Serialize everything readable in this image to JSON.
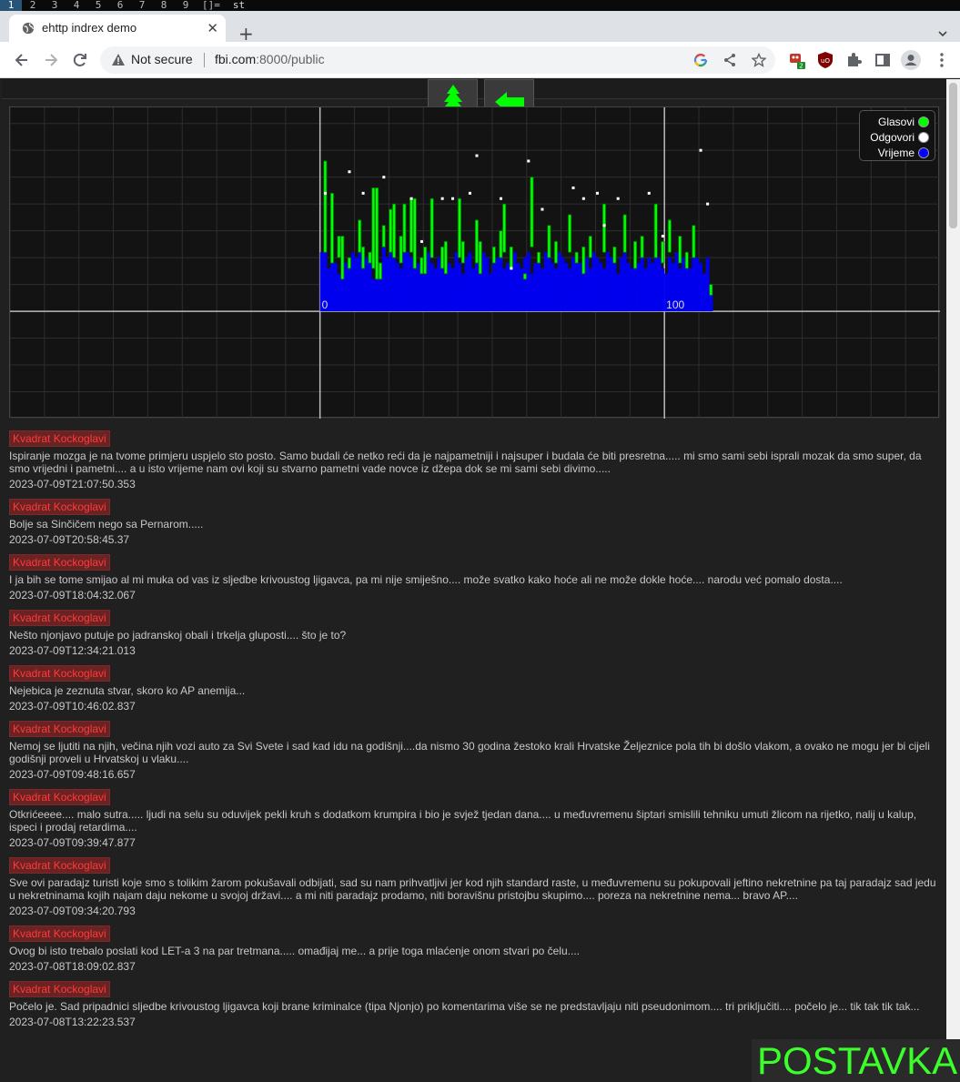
{
  "wm": {
    "workspaces": [
      "1",
      "2",
      "3",
      "4",
      "5",
      "6",
      "7",
      "8",
      "9"
    ],
    "active_workspace": "1",
    "layout": "[]=",
    "title": "st"
  },
  "browser": {
    "tab_title": "ehttp indrex demo",
    "security_label": "Not secure",
    "url_host": "fbi.com",
    "url_rest": ":8000/public",
    "extension_badge": "2"
  },
  "nav": {
    "tree_icon": "tree-icon",
    "back_icon": "arrow-left-icon",
    "accent": "#00ff00"
  },
  "chart_data": {
    "type": "bar",
    "xlim": [
      -90,
      180
    ],
    "ylim": [
      -20,
      38
    ],
    "x_tick_labels": [
      "0",
      "100"
    ],
    "legend": {
      "placement": "top-right",
      "entries": [
        {
          "name": "Glasovi",
          "color": "#00ff00"
        },
        {
          "name": "Odgovori",
          "color": "#ffffff"
        },
        {
          "name": "Vrijeme",
          "color": "#0000ff"
        }
      ]
    },
    "series": [
      {
        "name": "Vrijeme",
        "color": "#0000ee",
        "values": [
          11,
          11,
          8,
          10,
          9,
          7,
          11,
          9,
          8,
          11,
          10,
          11,
          10,
          10,
          9,
          6,
          11,
          8,
          12,
          10,
          11,
          10,
          9,
          8,
          12,
          11,
          10,
          8,
          9,
          10,
          7,
          11,
          9,
          8,
          10,
          11,
          10,
          9,
          8,
          11,
          9,
          7,
          10,
          11,
          8,
          10,
          9,
          11,
          10,
          7,
          9,
          10,
          11,
          8,
          9,
          10,
          11,
          9,
          8,
          10,
          11,
          7,
          9,
          10,
          8,
          11,
          10,
          9,
          8,
          11,
          10,
          9,
          8,
          10,
          11,
          9,
          7,
          10,
          8,
          11,
          10,
          9,
          8,
          11,
          10,
          9,
          7,
          10,
          11,
          9,
          8,
          10,
          9,
          11,
          8,
          10,
          9,
          11,
          10,
          8,
          7,
          10,
          9,
          11,
          8,
          10,
          9,
          8,
          11,
          10,
          9,
          7,
          10,
          5
        ]
      },
      {
        "name": "Glasovi",
        "color": "#00ff00",
        "segments": [
          [
            1,
            11,
            17
          ],
          [
            3,
            9,
            13
          ],
          [
            5,
            10,
            4
          ],
          [
            6,
            6,
            8
          ],
          [
            8,
            8,
            2
          ],
          [
            11,
            11,
            6
          ],
          [
            12,
            8,
            4
          ],
          [
            14,
            9,
            2
          ],
          [
            15,
            8,
            15
          ],
          [
            16,
            6,
            17
          ],
          [
            17,
            9,
            -3
          ],
          [
            18,
            12,
            4
          ],
          [
            20,
            11,
            8
          ],
          [
            21,
            10,
            10
          ],
          [
            23,
            9,
            5
          ],
          [
            24,
            11,
            9
          ],
          [
            26,
            11,
            10
          ],
          [
            27,
            8,
            13
          ],
          [
            29,
            7,
            3
          ],
          [
            30,
            7,
            5
          ],
          [
            32,
            10,
            11
          ],
          [
            35,
            8,
            4
          ],
          [
            36,
            7,
            6
          ],
          [
            40,
            10,
            11
          ],
          [
            41,
            9,
            4
          ],
          [
            45,
            9,
            8
          ],
          [
            46,
            7,
            6
          ],
          [
            50,
            9,
            3
          ],
          [
            52,
            10,
            5
          ],
          [
            53,
            11,
            9
          ],
          [
            55,
            8,
            4
          ],
          [
            59,
            7,
            -1
          ],
          [
            61,
            12,
            13
          ],
          [
            63,
            9,
            2
          ],
          [
            66,
            10,
            6
          ],
          [
            68,
            9,
            4
          ],
          [
            72,
            11,
            7
          ],
          [
            74,
            9,
            2
          ],
          [
            76,
            7,
            5
          ],
          [
            78,
            10,
            4
          ],
          [
            82,
            11,
            9
          ],
          [
            85,
            9,
            3
          ],
          [
            88,
            11,
            7
          ],
          [
            91,
            8,
            5
          ],
          [
            93,
            10,
            4
          ],
          [
            97,
            10,
            10
          ],
          [
            99,
            9,
            4
          ],
          [
            101,
            11,
            6
          ],
          [
            104,
            9,
            5
          ],
          [
            106,
            8,
            3
          ],
          [
            108,
            10,
            6
          ],
          [
            113,
            5,
            -2
          ]
        ]
      },
      {
        "name": "Odgovori",
        "color": "#ffffff",
        "markers": [
          [
            1,
            22
          ],
          [
            8,
            26
          ],
          [
            12,
            22
          ],
          [
            18,
            25
          ],
          [
            26,
            21
          ],
          [
            29,
            13
          ],
          [
            35,
            21
          ],
          [
            38,
            21
          ],
          [
            43,
            22
          ],
          [
            45,
            29
          ],
          [
            52,
            21
          ],
          [
            55,
            8
          ],
          [
            60,
            28
          ],
          [
            64,
            19
          ],
          [
            73,
            23
          ],
          [
            76,
            21
          ],
          [
            80,
            22
          ],
          [
            82,
            16
          ],
          [
            86,
            21
          ],
          [
            95,
            22
          ],
          [
            99,
            14
          ],
          [
            110,
            30
          ],
          [
            112,
            20
          ]
        ]
      }
    ]
  },
  "comments": [
    {
      "author": "Kvadrat Kockoglavi",
      "text": "Ispiranje mozga je na tvome primjeru uspjelo sto posto. Samo budali će netko reći da je najpametniji i najsuper i budala će biti presretna..... mi smo sami sebi isprali mozak da smo super, da smo vrijedni i pametni.... a u isto vrijeme nam ovi koji su stvarno pametni vade novce iz džepa dok se mi sami sebi divimo.....",
      "date": "2023-07-09T21:07:50.353"
    },
    {
      "author": "Kvadrat Kockoglavi",
      "text": "Bolje sa Sinčičem nego sa Pernarom.....",
      "date": "2023-07-09T20:58:45.37"
    },
    {
      "author": "Kvadrat Kockoglavi",
      "text": "I ja bih se tome smijao al mi muka od vas iz sljedbe krivoustog ljigavca, pa mi nije smiješno.... može svatko kako hoće ali ne može dokle hoće.... narodu već pomalo dosta....",
      "date": "2023-07-09T18:04:32.067"
    },
    {
      "author": "Kvadrat Kockoglavi",
      "text": "Nešto njonjavo putuje po jadranskoj obali i trkelja gluposti.... što je to?",
      "date": "2023-07-09T12:34:21.013"
    },
    {
      "author": "Kvadrat Kockoglavi",
      "text": "Nejebica je zeznuta stvar, skoro ko AP anemija...",
      "date": "2023-07-09T10:46:02.837"
    },
    {
      "author": "Kvadrat Kockoglavi",
      "text": "Nemoj se ljutiti na njih, večina njih vozi auto za Svi Svete i sad kad idu na godišnji....da nismo 30 godina žestoko krali Hrvatske Željeznice pola tih bi došlo vlakom, a ovako ne mogu jer bi cijeli godišnji proveli u Hrvatskoj u vlaku....",
      "date": "2023-07-09T09:48:16.657"
    },
    {
      "author": "Kvadrat Kockoglavi",
      "text": "Otkrićeeee.... malo sutra..... ljudi na selu su oduvijek pekli kruh s dodatkom krumpira i bio je svjež tjedan dana.... u međuvremenu šiptari smislili tehniku umuti žlicom na rijetko, nalij u kalup, ispeci i prodaj retardima....",
      "date": "2023-07-09T09:39:47.877"
    },
    {
      "author": "Kvadrat Kockoglavi",
      "text": "Sve ovi paradajz turisti koje smo s tolikim žarom pokušavali odbijati, sad su nam prihvatljivi jer kod njih standard raste, u međuvremenu su pokupovali jeftino nekretnine pa taj paradajz sad jedu u nekretninama kojih najam daju nekome u svojoj državi.... a mi niti paradajz prodamo, niti boravišnu pristojbu skupimo.... poreza na nekretnine nema... bravo AP....",
      "date": "2023-07-09T09:34:20.793"
    },
    {
      "author": "Kvadrat Kockoglavi",
      "text": "Ovog bi isto trebalo poslati kod LET-a 3 na par tretmana..... omađijaj me... a prije toga mlaćenje onom stvari po čelu....",
      "date": "2023-07-08T18:09:02.837"
    },
    {
      "author": "Kvadrat Kockoglavi",
      "text": "Počelo je. Sad pripadnici sljedbe krivoustog ljigavca koji brane kriminalce (tipa Njonjo) po komentarima više se ne predstavljaju niti pseudonimom.... tri priključiti.... počelo je... tik tak tik tak...",
      "date": "2023-07-08T13:22:23.537"
    }
  ],
  "postavka_label": "POSTAVKA"
}
